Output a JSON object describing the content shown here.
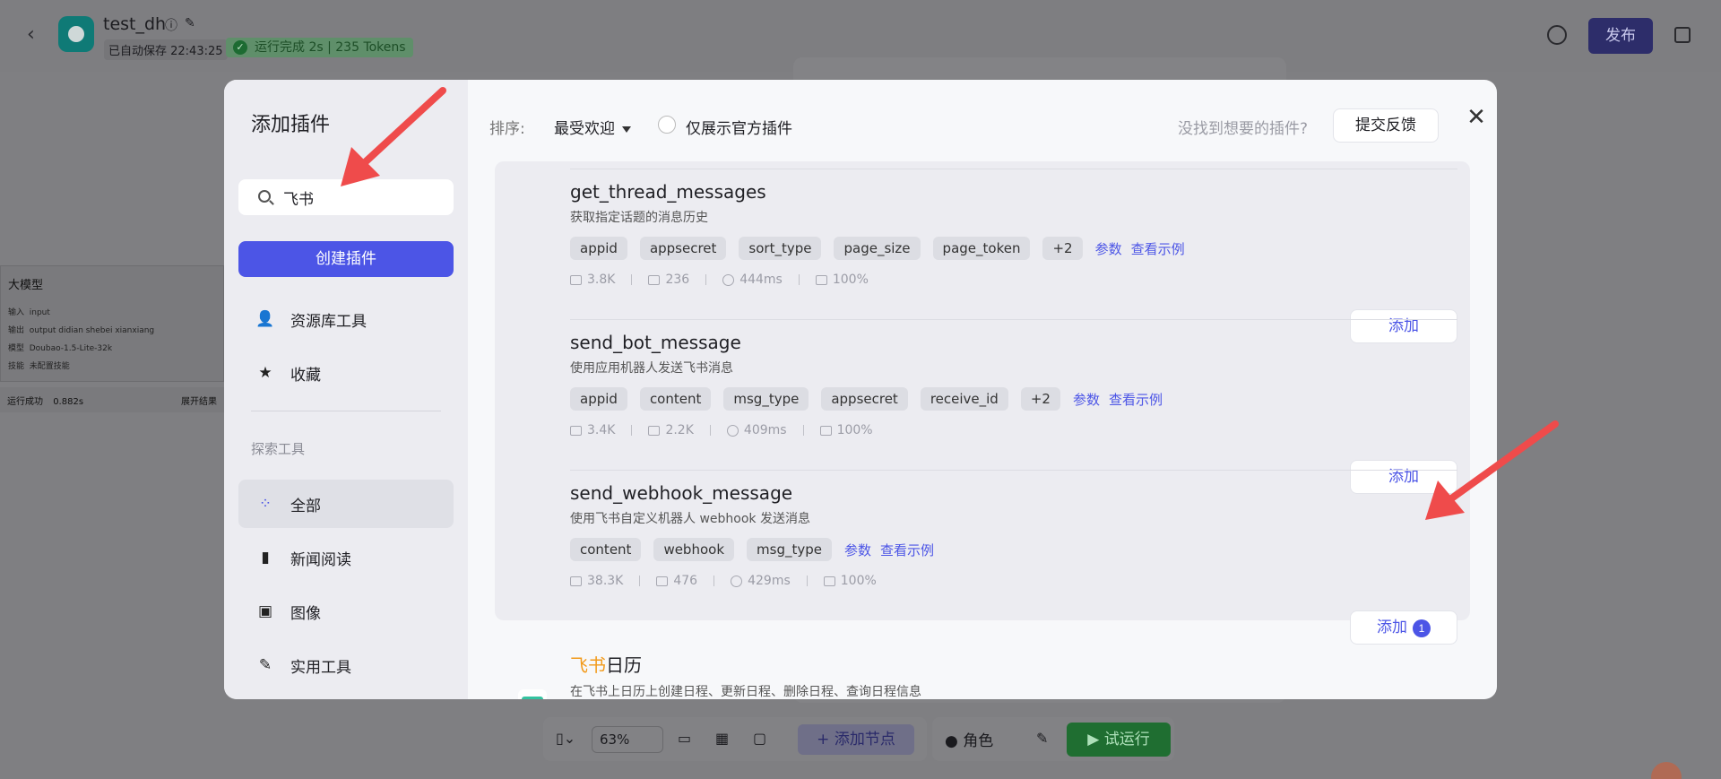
{
  "header": {
    "app_name": "test_dh",
    "autosave": "已自动保存 22:43:25",
    "run_status": "运行完成 2s | 235 Tokens",
    "publish_label": "发布"
  },
  "canvas": {
    "node_title": "大模型",
    "node_input_label": "输入",
    "node_input_value": "input",
    "node_output_label": "输出",
    "node_outputs": "output  didian  shebei  xianxiang",
    "node_model_label": "模型",
    "node_model_value": "Doubao-1.5-Lite-32k",
    "node_skill_label": "技能",
    "node_skill_value": "未配置技能",
    "node_status": "运行成功",
    "node_time": "0.882s",
    "node_expand": "展开结果"
  },
  "toolbar": {
    "zoom": "63%",
    "add_node": "添加节点",
    "role": "角色",
    "trial_run": "试运行"
  },
  "modal": {
    "title": "添加插件",
    "search_value": "飞书",
    "create_label": "创建插件",
    "nav": [
      {
        "label": "资源库工具",
        "icon": "person-icon"
      },
      {
        "label": "收藏",
        "icon": "star-icon"
      }
    ],
    "section_title": "探索工具",
    "categories": [
      {
        "label": "全部",
        "icon": "grid-icon",
        "active": true
      },
      {
        "label": "新闻阅读",
        "icon": "book-icon"
      },
      {
        "label": "图像",
        "icon": "image-icon"
      },
      {
        "label": "实用工具",
        "icon": "wrench-icon"
      }
    ],
    "sort_label": "排序:",
    "sort_value": "最受欢迎",
    "official_only": "仅展示官方插件",
    "not_found": "没找到想要的插件?",
    "feedback": "提交反馈",
    "tools": [
      {
        "name": "get_thread_messages",
        "desc": "获取指定话题的消息历史",
        "tags": [
          "appid",
          "appsecret",
          "sort_type",
          "page_size",
          "page_token",
          "+2"
        ],
        "params_link": "参数",
        "example_link": "查看示例",
        "uses": "3.8K",
        "bots": "236",
        "latency": "444ms",
        "success": "100%",
        "add_label": "添加"
      },
      {
        "name": "send_bot_message",
        "desc": "使用应用机器人发送飞书消息",
        "tags": [
          "appid",
          "content",
          "msg_type",
          "appsecret",
          "receive_id",
          "+2"
        ],
        "params_link": "参数",
        "example_link": "查看示例",
        "uses": "3.4K",
        "bots": "2.2K",
        "latency": "409ms",
        "success": "100%",
        "add_label": "添加"
      },
      {
        "name": "send_webhook_message",
        "desc": "使用飞书自定义机器人 webhook 发送消息",
        "tags": [
          "content",
          "webhook",
          "msg_type"
        ],
        "params_link": "参数",
        "example_link": "查看示例",
        "uses": "38.3K",
        "bots": "476",
        "latency": "429ms",
        "success": "100%",
        "add_label": "添加",
        "badge": "1"
      }
    ],
    "next_plugin": {
      "name_highlight": "飞书",
      "name_rest": "日历",
      "desc": "在飞书上日历上创建日程、更新日程、删除日程、查询日程信息"
    }
  },
  "colors": {
    "accent": "#4c55e6",
    "highlight": "#f29a1b",
    "arrow": "#ef4b4b"
  }
}
